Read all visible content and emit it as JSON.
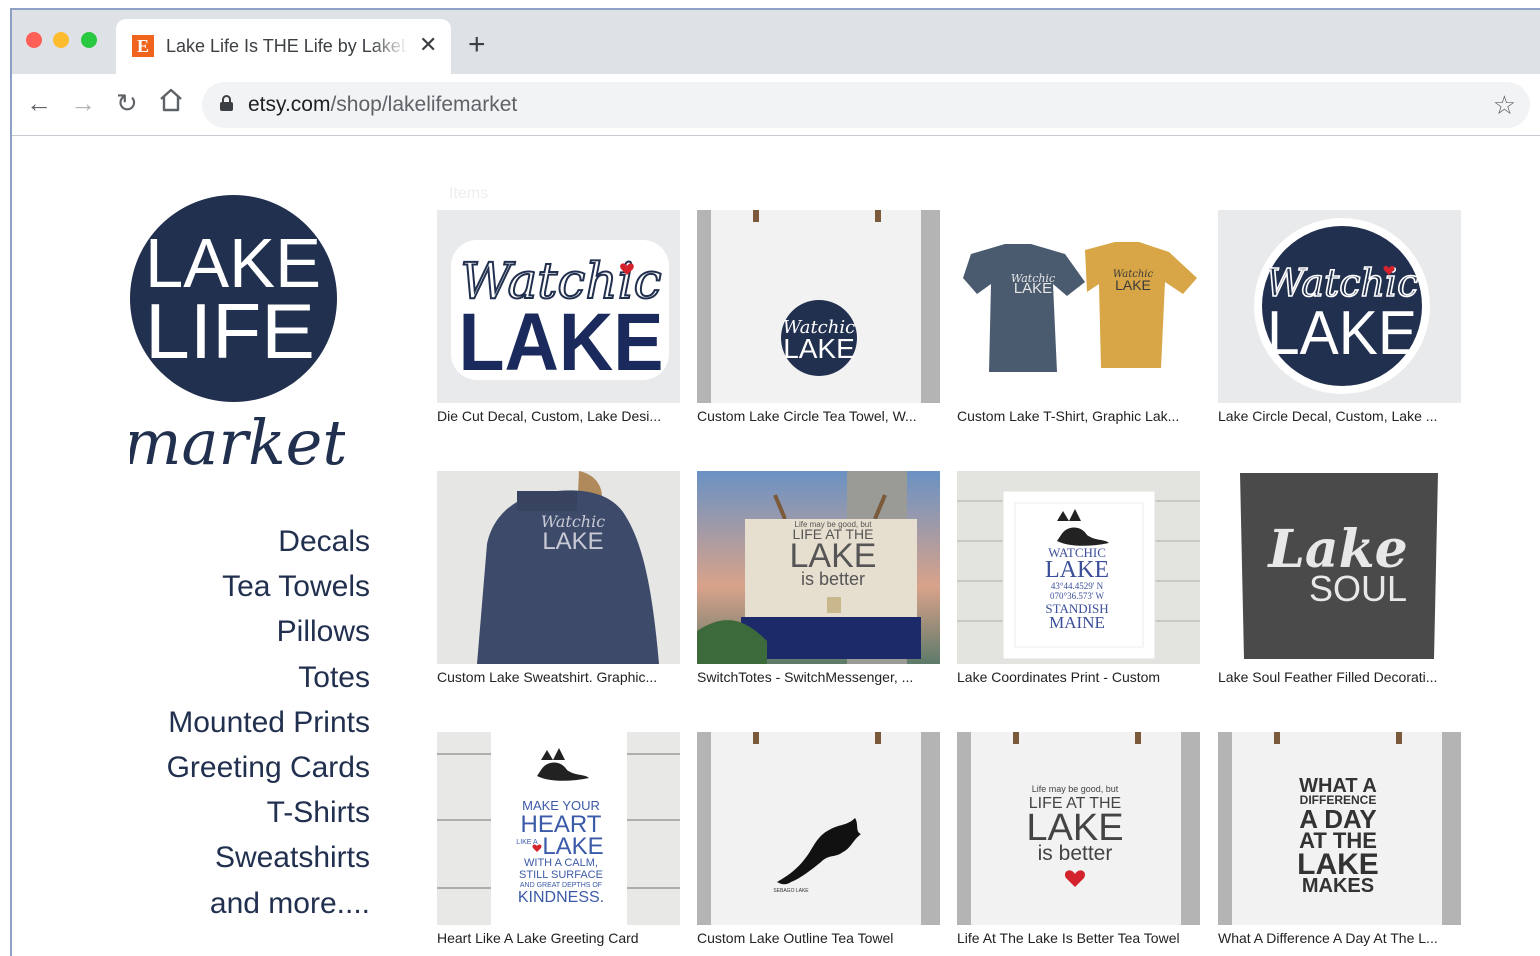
{
  "browser": {
    "tab_title": "Lake Life Is THE Life by LakeLifeMarket",
    "tab_close_icon": "close-icon",
    "new_tab_icon": "plus-icon",
    "url_domain": "etsy.com",
    "url_path": "/shop/lakelifemarket"
  },
  "shop": {
    "logo_lines": [
      "LAKE",
      "LIFE"
    ],
    "logo_script": "market",
    "logo_color": "#22304f",
    "faint_heading": "Items",
    "categories": [
      "Decals",
      "Tea Towels",
      "Pillows",
      "Totes",
      "Mounted Prints",
      "Greeting Cards",
      "T-Shirts",
      "Sweatshirts",
      "and more...."
    ]
  },
  "listings": [
    {
      "caption": "Die Cut Decal, Custom, Lake Desi...",
      "image_text": [
        "Watchic",
        "LAKE"
      ]
    },
    {
      "caption": "Custom Lake Circle Tea Towel, W...",
      "image_text": [
        "Watchic",
        "LAKE"
      ]
    },
    {
      "caption": "Custom Lake T-Shirt, Graphic Lak...",
      "image_text": [
        "Watchic",
        "LAKE"
      ]
    },
    {
      "caption": "Lake Circle Decal, Custom, Lake ...",
      "image_text": [
        "Watchic",
        "LAKE"
      ]
    },
    {
      "caption": "Custom Lake Sweatshirt. Graphic...",
      "image_text": [
        "Watchic",
        "LAKE"
      ]
    },
    {
      "caption": "SwitchTotes - SwitchMessenger, ...",
      "image_text": [
        "Life may be good, but",
        "LIFE AT THE",
        "LAKE",
        "is better"
      ]
    },
    {
      "caption": "Lake Coordinates Print - Custom",
      "image_text": [
        "WATCHIC",
        "LAKE",
        "43°44.4529' N",
        "070°36.573' W",
        "STANDISH",
        "MAINE"
      ]
    },
    {
      "caption": "Lake Soul Feather Filled Decorati...",
      "image_text": [
        "Lake",
        "SOUL"
      ]
    },
    {
      "caption": "Heart Like A Lake Greeting Card",
      "image_text": [
        "MAKE YOUR",
        "HEART",
        "LIKE A",
        "LAKE",
        "WITH A CALM,",
        "STILL SURFACE",
        "AND GREAT DEPTHS OF",
        "KINDNESS."
      ]
    },
    {
      "caption": "Custom Lake Outline Tea Towel",
      "image_text": [
        "SEBAGO LAKE"
      ]
    },
    {
      "caption": "Life At The Lake Is Better Tea Towel",
      "image_text": [
        "Life may be good, but",
        "LIFE AT THE",
        "LAKE",
        "is better"
      ]
    },
    {
      "caption": "What A Difference A Day At The L...",
      "image_text": [
        "WHAT A",
        "DIFFERENCE",
        "A DAY",
        "AT THE",
        "LAKE",
        "MAKES"
      ]
    }
  ]
}
